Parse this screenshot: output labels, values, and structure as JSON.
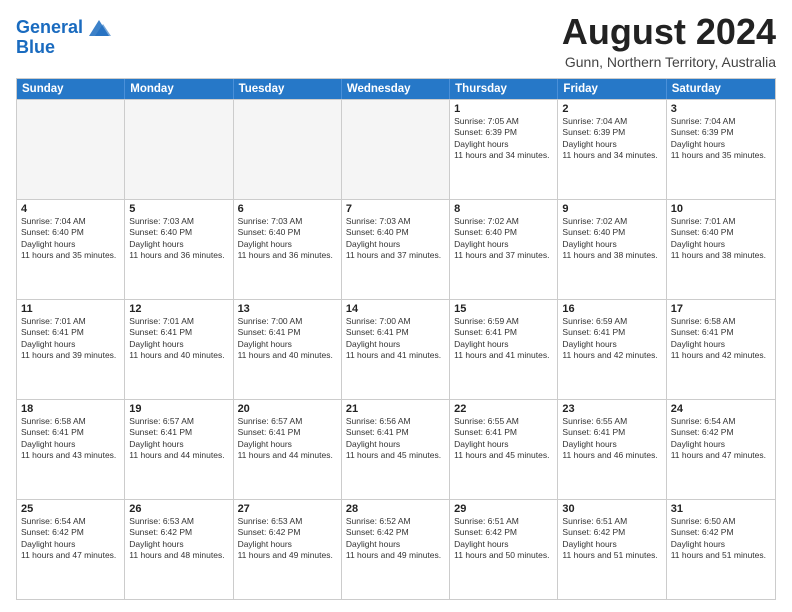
{
  "header": {
    "logo_line1": "General",
    "logo_line2": "Blue",
    "month": "August 2024",
    "location": "Gunn, Northern Territory, Australia"
  },
  "days": [
    "Sunday",
    "Monday",
    "Tuesday",
    "Wednesday",
    "Thursday",
    "Friday",
    "Saturday"
  ],
  "weeks": [
    [
      {
        "num": "",
        "sunrise": "",
        "sunset": "",
        "daylight": "",
        "empty": true
      },
      {
        "num": "",
        "sunrise": "",
        "sunset": "",
        "daylight": "",
        "empty": true
      },
      {
        "num": "",
        "sunrise": "",
        "sunset": "",
        "daylight": "",
        "empty": true
      },
      {
        "num": "",
        "sunrise": "",
        "sunset": "",
        "daylight": "",
        "empty": true
      },
      {
        "num": "1",
        "sunrise": "7:05 AM",
        "sunset": "6:39 PM",
        "daylight": "11 hours and 34 minutes."
      },
      {
        "num": "2",
        "sunrise": "7:04 AM",
        "sunset": "6:39 PM",
        "daylight": "11 hours and 34 minutes."
      },
      {
        "num": "3",
        "sunrise": "7:04 AM",
        "sunset": "6:39 PM",
        "daylight": "11 hours and 35 minutes."
      }
    ],
    [
      {
        "num": "4",
        "sunrise": "7:04 AM",
        "sunset": "6:40 PM",
        "daylight": "11 hours and 35 minutes."
      },
      {
        "num": "5",
        "sunrise": "7:03 AM",
        "sunset": "6:40 PM",
        "daylight": "11 hours and 36 minutes."
      },
      {
        "num": "6",
        "sunrise": "7:03 AM",
        "sunset": "6:40 PM",
        "daylight": "11 hours and 36 minutes."
      },
      {
        "num": "7",
        "sunrise": "7:03 AM",
        "sunset": "6:40 PM",
        "daylight": "11 hours and 37 minutes."
      },
      {
        "num": "8",
        "sunrise": "7:02 AM",
        "sunset": "6:40 PM",
        "daylight": "11 hours and 37 minutes."
      },
      {
        "num": "9",
        "sunrise": "7:02 AM",
        "sunset": "6:40 PM",
        "daylight": "11 hours and 38 minutes."
      },
      {
        "num": "10",
        "sunrise": "7:01 AM",
        "sunset": "6:40 PM",
        "daylight": "11 hours and 38 minutes."
      }
    ],
    [
      {
        "num": "11",
        "sunrise": "7:01 AM",
        "sunset": "6:41 PM",
        "daylight": "11 hours and 39 minutes."
      },
      {
        "num": "12",
        "sunrise": "7:01 AM",
        "sunset": "6:41 PM",
        "daylight": "11 hours and 40 minutes."
      },
      {
        "num": "13",
        "sunrise": "7:00 AM",
        "sunset": "6:41 PM",
        "daylight": "11 hours and 40 minutes."
      },
      {
        "num": "14",
        "sunrise": "7:00 AM",
        "sunset": "6:41 PM",
        "daylight": "11 hours and 41 minutes."
      },
      {
        "num": "15",
        "sunrise": "6:59 AM",
        "sunset": "6:41 PM",
        "daylight": "11 hours and 41 minutes."
      },
      {
        "num": "16",
        "sunrise": "6:59 AM",
        "sunset": "6:41 PM",
        "daylight": "11 hours and 42 minutes."
      },
      {
        "num": "17",
        "sunrise": "6:58 AM",
        "sunset": "6:41 PM",
        "daylight": "11 hours and 42 minutes."
      }
    ],
    [
      {
        "num": "18",
        "sunrise": "6:58 AM",
        "sunset": "6:41 PM",
        "daylight": "11 hours and 43 minutes."
      },
      {
        "num": "19",
        "sunrise": "6:57 AM",
        "sunset": "6:41 PM",
        "daylight": "11 hours and 44 minutes."
      },
      {
        "num": "20",
        "sunrise": "6:57 AM",
        "sunset": "6:41 PM",
        "daylight": "11 hours and 44 minutes."
      },
      {
        "num": "21",
        "sunrise": "6:56 AM",
        "sunset": "6:41 PM",
        "daylight": "11 hours and 45 minutes."
      },
      {
        "num": "22",
        "sunrise": "6:55 AM",
        "sunset": "6:41 PM",
        "daylight": "11 hours and 45 minutes."
      },
      {
        "num": "23",
        "sunrise": "6:55 AM",
        "sunset": "6:41 PM",
        "daylight": "11 hours and 46 minutes."
      },
      {
        "num": "24",
        "sunrise": "6:54 AM",
        "sunset": "6:42 PM",
        "daylight": "11 hours and 47 minutes."
      }
    ],
    [
      {
        "num": "25",
        "sunrise": "6:54 AM",
        "sunset": "6:42 PM",
        "daylight": "11 hours and 47 minutes."
      },
      {
        "num": "26",
        "sunrise": "6:53 AM",
        "sunset": "6:42 PM",
        "daylight": "11 hours and 48 minutes."
      },
      {
        "num": "27",
        "sunrise": "6:53 AM",
        "sunset": "6:42 PM",
        "daylight": "11 hours and 49 minutes."
      },
      {
        "num": "28",
        "sunrise": "6:52 AM",
        "sunset": "6:42 PM",
        "daylight": "11 hours and 49 minutes."
      },
      {
        "num": "29",
        "sunrise": "6:51 AM",
        "sunset": "6:42 PM",
        "daylight": "11 hours and 50 minutes."
      },
      {
        "num": "30",
        "sunrise": "6:51 AM",
        "sunset": "6:42 PM",
        "daylight": "11 hours and 51 minutes."
      },
      {
        "num": "31",
        "sunrise": "6:50 AM",
        "sunset": "6:42 PM",
        "daylight": "11 hours and 51 minutes."
      }
    ]
  ]
}
